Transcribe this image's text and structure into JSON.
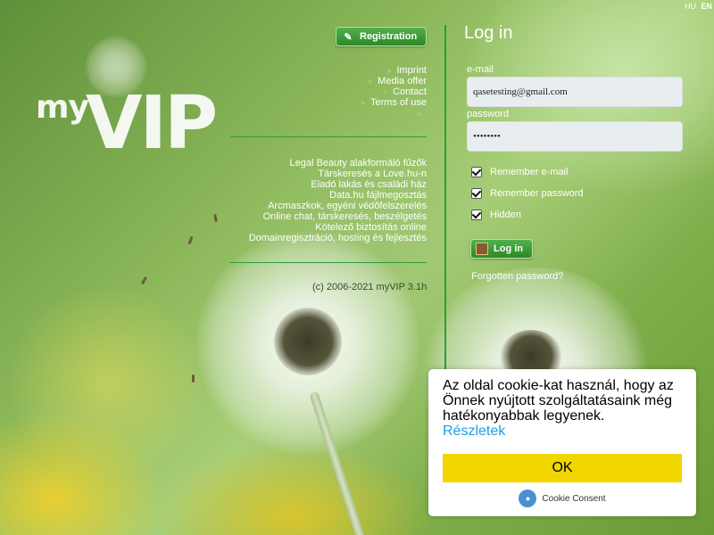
{
  "lang": {
    "hu": "HU",
    "en": "EN"
  },
  "logo": {
    "my": "my",
    "vip": "VIP"
  },
  "registration_label": "Registration",
  "menu_links": [
    "Imprint",
    "Media offer",
    "Contact",
    "Terms of use",
    ""
  ],
  "partner_links": [
    "Legal Beauty alakformáló fűzők",
    "Társkeresés a Love.hu-n",
    "Eladó lakás és családi ház",
    "Data.hu fájlmegosztás",
    "Arcmaszkok, egyéni védőfelszerelés",
    "Online chat, társkeresés, beszélgetés",
    "Kötelező biztosítás online",
    "Domainregisztráció, hosting és fejlesztés"
  ],
  "copyright": "(c) 2006-2021 myVIP 3.1h",
  "login": {
    "title": "Log in",
    "email_label": "e-mail",
    "email_value": "qasetesting@gmail.com",
    "password_label": "password",
    "password_value": "••••••••",
    "remember_email": "Remember e-mail",
    "remember_password": "Remember password",
    "hidden": "Hidden",
    "button": "Log in",
    "forgot": "Forgotten password?"
  },
  "cookie": {
    "message": "Az oldal cookie-kat használ, hogy az Önnek nyújtott szolgáltatásaink még hatékonyabbak legyenek.",
    "more": "Részletek",
    "ok": "OK",
    "brand": "Cookie Consent"
  },
  "colors": {
    "accent_green": "#2f9d3a",
    "cookie_button": "#f1d600",
    "link_blue": "#1aa1e0"
  }
}
